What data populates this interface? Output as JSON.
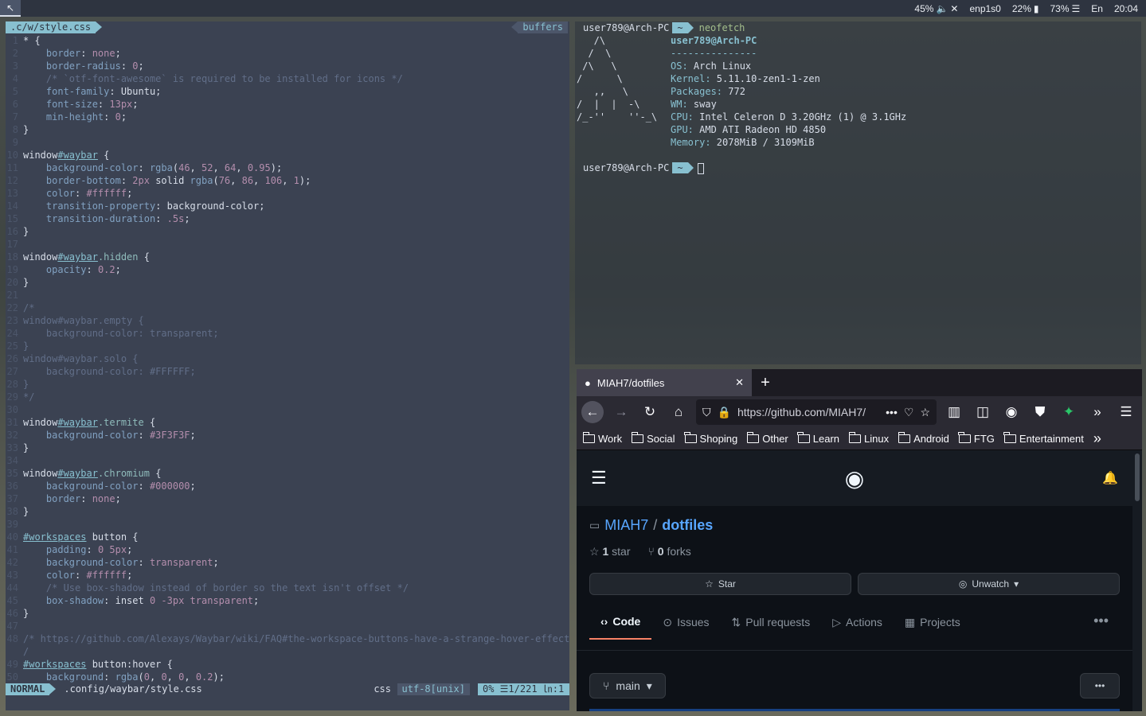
{
  "topbar": {
    "volume": "45%",
    "network": "enp1s0",
    "battery": "22%",
    "memory": "73%",
    "language": "En",
    "clock": "20:04"
  },
  "editor": {
    "tab_file": ".c/w/style.css",
    "tab_buffers": "buffers",
    "lines": [
      {
        "n": "1",
        "segs": [
          [
            "tx",
            "* {"
          ]
        ]
      },
      {
        "n": "2",
        "segs": [
          [
            "pr",
            "    border"
          ],
          [
            "tx",
            ": "
          ],
          [
            "val",
            "none"
          ],
          [
            "tx",
            ";"
          ]
        ]
      },
      {
        "n": "3",
        "segs": [
          [
            "pr",
            "    border-radius"
          ],
          [
            "tx",
            ": "
          ],
          [
            "val",
            "0"
          ],
          [
            "tx",
            ";"
          ]
        ]
      },
      {
        "n": "4",
        "segs": [
          [
            "cm",
            "    /* `otf-font-awesome` is required to be installed for icons */"
          ]
        ]
      },
      {
        "n": "5",
        "segs": [
          [
            "pr",
            "    font-family"
          ],
          [
            "tx",
            ": Ubuntu;"
          ]
        ]
      },
      {
        "n": "6",
        "segs": [
          [
            "pr",
            "    font-size"
          ],
          [
            "tx",
            ": "
          ],
          [
            "val",
            "13px"
          ],
          [
            "tx",
            ";"
          ]
        ]
      },
      {
        "n": "7",
        "segs": [
          [
            "pr",
            "    min-height"
          ],
          [
            "tx",
            ": "
          ],
          [
            "val",
            "0"
          ],
          [
            "tx",
            ";"
          ]
        ]
      },
      {
        "n": "8",
        "segs": [
          [
            "tx",
            "}"
          ]
        ]
      },
      {
        "n": "9",
        "segs": []
      },
      {
        "n": "10",
        "segs": [
          [
            "tx",
            "window"
          ],
          [
            "id",
            "#waybar"
          ],
          [
            "tx",
            " {"
          ]
        ]
      },
      {
        "n": "11",
        "segs": [
          [
            "pr",
            "    background-color"
          ],
          [
            "tx",
            ": "
          ],
          [
            "pr",
            "rgba"
          ],
          [
            "tx",
            "("
          ],
          [
            "val",
            "46"
          ],
          [
            "tx",
            ", "
          ],
          [
            "val",
            "52"
          ],
          [
            "tx",
            ", "
          ],
          [
            "val",
            "64"
          ],
          [
            "tx",
            ", "
          ],
          [
            "val",
            "0.95"
          ],
          [
            "tx",
            ");"
          ]
        ]
      },
      {
        "n": "12",
        "segs": [
          [
            "pr",
            "    border-bottom"
          ],
          [
            "tx",
            ": "
          ],
          [
            "val",
            "2px"
          ],
          [
            "tx",
            " solid "
          ],
          [
            "pr",
            "rgba"
          ],
          [
            "tx",
            "("
          ],
          [
            "val",
            "76"
          ],
          [
            "tx",
            ", "
          ],
          [
            "val",
            "86"
          ],
          [
            "tx",
            ", "
          ],
          [
            "val",
            "106"
          ],
          [
            "tx",
            ", "
          ],
          [
            "val",
            "1"
          ],
          [
            "tx",
            ");"
          ]
        ]
      },
      {
        "n": "13",
        "segs": [
          [
            "pr",
            "    color"
          ],
          [
            "tx",
            ": "
          ],
          [
            "val",
            "#ffffff"
          ],
          [
            "tx",
            ";"
          ]
        ]
      },
      {
        "n": "14",
        "segs": [
          [
            "pr",
            "    transition-property"
          ],
          [
            "tx",
            ": background-color;"
          ]
        ]
      },
      {
        "n": "15",
        "segs": [
          [
            "pr",
            "    transition-duration"
          ],
          [
            "tx",
            ": "
          ],
          [
            "val",
            ".5s"
          ],
          [
            "tx",
            ";"
          ]
        ]
      },
      {
        "n": "16",
        "segs": [
          [
            "tx",
            "}"
          ]
        ]
      },
      {
        "n": "17",
        "segs": []
      },
      {
        "n": "18",
        "segs": [
          [
            "tx",
            "window"
          ],
          [
            "id",
            "#waybar"
          ],
          [
            "sel",
            ".hidden"
          ],
          [
            "tx",
            " {"
          ]
        ]
      },
      {
        "n": "19",
        "segs": [
          [
            "pr",
            "    opacity"
          ],
          [
            "tx",
            ": "
          ],
          [
            "val",
            "0.2"
          ],
          [
            "tx",
            ";"
          ]
        ]
      },
      {
        "n": "20",
        "segs": [
          [
            "tx",
            "}"
          ]
        ]
      },
      {
        "n": "21",
        "segs": []
      },
      {
        "n": "22",
        "segs": [
          [
            "cm",
            "/*"
          ]
        ]
      },
      {
        "n": "23",
        "segs": [
          [
            "cm",
            "window#waybar.empty {"
          ]
        ]
      },
      {
        "n": "24",
        "segs": [
          [
            "cm",
            "    background-color: transparent;"
          ]
        ]
      },
      {
        "n": "25",
        "segs": [
          [
            "cm",
            "}"
          ]
        ]
      },
      {
        "n": "26",
        "segs": [
          [
            "cm",
            "window#waybar.solo {"
          ]
        ]
      },
      {
        "n": "27",
        "segs": [
          [
            "cm",
            "    background-color: #FFFFFF;"
          ]
        ]
      },
      {
        "n": "28",
        "segs": [
          [
            "cm",
            "}"
          ]
        ]
      },
      {
        "n": "29",
        "segs": [
          [
            "cm",
            "*/"
          ]
        ]
      },
      {
        "n": "30",
        "segs": []
      },
      {
        "n": "31",
        "segs": [
          [
            "tx",
            "window"
          ],
          [
            "id",
            "#waybar"
          ],
          [
            "sel",
            ".termite"
          ],
          [
            "tx",
            " {"
          ]
        ]
      },
      {
        "n": "32",
        "segs": [
          [
            "pr",
            "    background-color"
          ],
          [
            "tx",
            ": "
          ],
          [
            "val",
            "#3F3F3F"
          ],
          [
            "tx",
            ";"
          ]
        ]
      },
      {
        "n": "33",
        "segs": [
          [
            "tx",
            "}"
          ]
        ]
      },
      {
        "n": "34",
        "segs": []
      },
      {
        "n": "35",
        "segs": [
          [
            "tx",
            "window"
          ],
          [
            "id",
            "#waybar"
          ],
          [
            "sel",
            ".chromium"
          ],
          [
            "tx",
            " {"
          ]
        ]
      },
      {
        "n": "36",
        "segs": [
          [
            "pr",
            "    background-color"
          ],
          [
            "tx",
            ": "
          ],
          [
            "val",
            "#000000"
          ],
          [
            "tx",
            ";"
          ]
        ]
      },
      {
        "n": "37",
        "segs": [
          [
            "pr",
            "    border"
          ],
          [
            "tx",
            ": "
          ],
          [
            "val",
            "none"
          ],
          [
            "tx",
            ";"
          ]
        ]
      },
      {
        "n": "38",
        "segs": [
          [
            "tx",
            "}"
          ]
        ]
      },
      {
        "n": "39",
        "segs": []
      },
      {
        "n": "40",
        "segs": [
          [
            "id",
            "#workspaces"
          ],
          [
            "tx",
            " button {"
          ]
        ]
      },
      {
        "n": "41",
        "segs": [
          [
            "pr",
            "    padding"
          ],
          [
            "tx",
            ": "
          ],
          [
            "val",
            "0 5px"
          ],
          [
            "tx",
            ";"
          ]
        ]
      },
      {
        "n": "42",
        "segs": [
          [
            "pr",
            "    background-color"
          ],
          [
            "tx",
            ": "
          ],
          [
            "val",
            "transparent"
          ],
          [
            "tx",
            ";"
          ]
        ]
      },
      {
        "n": "43",
        "segs": [
          [
            "pr",
            "    color"
          ],
          [
            "tx",
            ": "
          ],
          [
            "val",
            "#ffffff"
          ],
          [
            "tx",
            ";"
          ]
        ]
      },
      {
        "n": "44",
        "segs": [
          [
            "cm",
            "    /* Use box-shadow instead of border so the text isn't offset */"
          ]
        ]
      },
      {
        "n": "45",
        "segs": [
          [
            "pr",
            "    box-shadow"
          ],
          [
            "tx",
            ": inset "
          ],
          [
            "val",
            "0 -3px"
          ],
          [
            "tx",
            " "
          ],
          [
            "val",
            "transparent"
          ],
          [
            "tx",
            ";"
          ]
        ]
      },
      {
        "n": "46",
        "segs": [
          [
            "tx",
            "}"
          ]
        ]
      },
      {
        "n": "47",
        "segs": []
      },
      {
        "n": "48",
        "segs": [
          [
            "cm",
            "/* https://github.com/Alexays/Waybar/wiki/FAQ#the-workspace-buttons-have-a-strange-hover-effect *"
          ]
        ]
      },
      {
        "n": "",
        "segs": [
          [
            "cm",
            "/"
          ]
        ]
      },
      {
        "n": "49",
        "segs": [
          [
            "id",
            "#workspaces"
          ],
          [
            "tx",
            " button:hover {"
          ]
        ]
      },
      {
        "n": "50",
        "segs": [
          [
            "pr",
            "    background"
          ],
          [
            "tx",
            ": "
          ],
          [
            "pr",
            "rgba"
          ],
          [
            "tx",
            "("
          ],
          [
            "val",
            "0"
          ],
          [
            "tx",
            ", "
          ],
          [
            "val",
            "0"
          ],
          [
            "tx",
            ", "
          ],
          [
            "val",
            "0"
          ],
          [
            "tx",
            ", "
          ],
          [
            "val",
            "0.2"
          ],
          [
            "tx",
            ");"
          ]
        ]
      }
    ],
    "status": {
      "mode": "NORMAL",
      "path": ".config/waybar/style.css",
      "filetype": "css",
      "encoding": "utf-8[unix]",
      "position": "0% ☰1/221 ㏑:1"
    }
  },
  "terminal": {
    "prompt_host": "user789@Arch-PC",
    "prompt_dir": "~",
    "command": "neofetch",
    "logo": [
      "   /\\",
      "  /  \\",
      " /\\   \\",
      "/      \\",
      "   ,,   \\",
      "/  |  |  -\\",
      "/_-''    ''-_\\"
    ],
    "title": "user789@Arch-PC",
    "sep": "---------------",
    "info": [
      {
        "k": "OS",
        "v": " Arch Linux"
      },
      {
        "k": "Kernel",
        "v": " 5.11.10-zen1-1-zen"
      },
      {
        "k": "Packages",
        "v": " 772"
      },
      {
        "k": "WM",
        "v": " sway"
      },
      {
        "k": "CPU",
        "v": " Intel Celeron D 3.20GHz (1) @ 3.1GHz"
      },
      {
        "k": "GPU",
        "v": " AMD ATI Radeon HD 4850"
      },
      {
        "k": "Memory",
        "v": " 2078MiB / 3109MiB"
      }
    ]
  },
  "firefox": {
    "tab_title": "MIAH7/dotfiles",
    "url": "https://github.com/MIAH7/",
    "bookmarks": [
      "Work",
      "Social",
      "Shoping",
      "Other",
      "Learn",
      "Linux",
      "Android",
      "FTG",
      "Entertainment"
    ]
  },
  "github": {
    "owner": "MIAH7",
    "repo": "dotfiles",
    "stars": "1",
    "stars_label": "star",
    "forks": "0",
    "forks_label": "forks",
    "star_btn": "Star",
    "watch_btn": "Unwatch",
    "tabs": [
      "Code",
      "Issues",
      "Pull requests",
      "Actions",
      "Projects"
    ],
    "branch": "main"
  }
}
